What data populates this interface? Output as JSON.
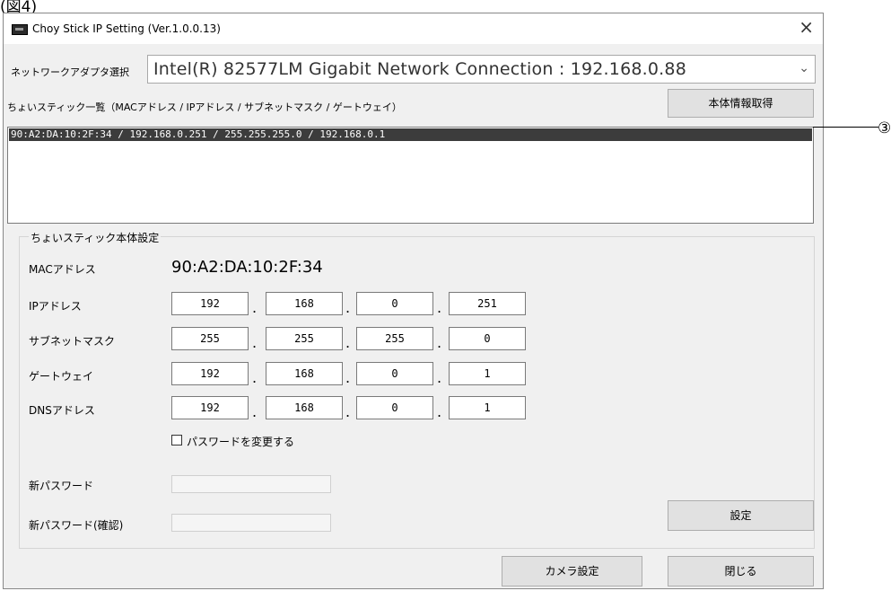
{
  "figure_label": "(図4)",
  "window": {
    "title": "Choy Stick IP Setting (Ver.1.0.0.13)",
    "close_glyph": "×"
  },
  "adapter": {
    "label": "ネットワークアダプタ選択",
    "selected": "Intel(R) 82577LM Gigabit Network Connection : 192.168.0.88",
    "caret": "⌄"
  },
  "list": {
    "label": "ちょいスティック一覧（MACアドレス / IPアドレス / サブネットマスク / ゲートウェイ）",
    "get_button": "本体情報取得",
    "items": [
      "90:A2:DA:10:2F:34 / 192.168.0.251 / 255.255.255.0 / 192.168.0.1"
    ],
    "callout": "③"
  },
  "settings": {
    "group_title": "ちょいスティック本体設定",
    "mac_label": "MACアドレス",
    "mac_value": "90:A2:DA:10:2F:34",
    "ip_label": "IPアドレス",
    "ip": [
      "192",
      "168",
      "0",
      "251"
    ],
    "subnet_label": "サブネットマスク",
    "subnet": [
      "255",
      "255",
      "255",
      "0"
    ],
    "gateway_label": "ゲートウェイ",
    "gateway": [
      "192",
      "168",
      "0",
      "1"
    ],
    "dns_label": "DNSアドレス",
    "dns": [
      "192",
      "168",
      "0",
      "1"
    ],
    "dot": ".",
    "change_password_label": "パスワードを変更する",
    "change_password_checked": false,
    "new_password_label": "新パスワード",
    "new_password_confirm_label": "新パスワード(確認)",
    "apply_button": "設定"
  },
  "footer": {
    "camera_button": "カメラ設定",
    "close_button": "閉じる"
  }
}
